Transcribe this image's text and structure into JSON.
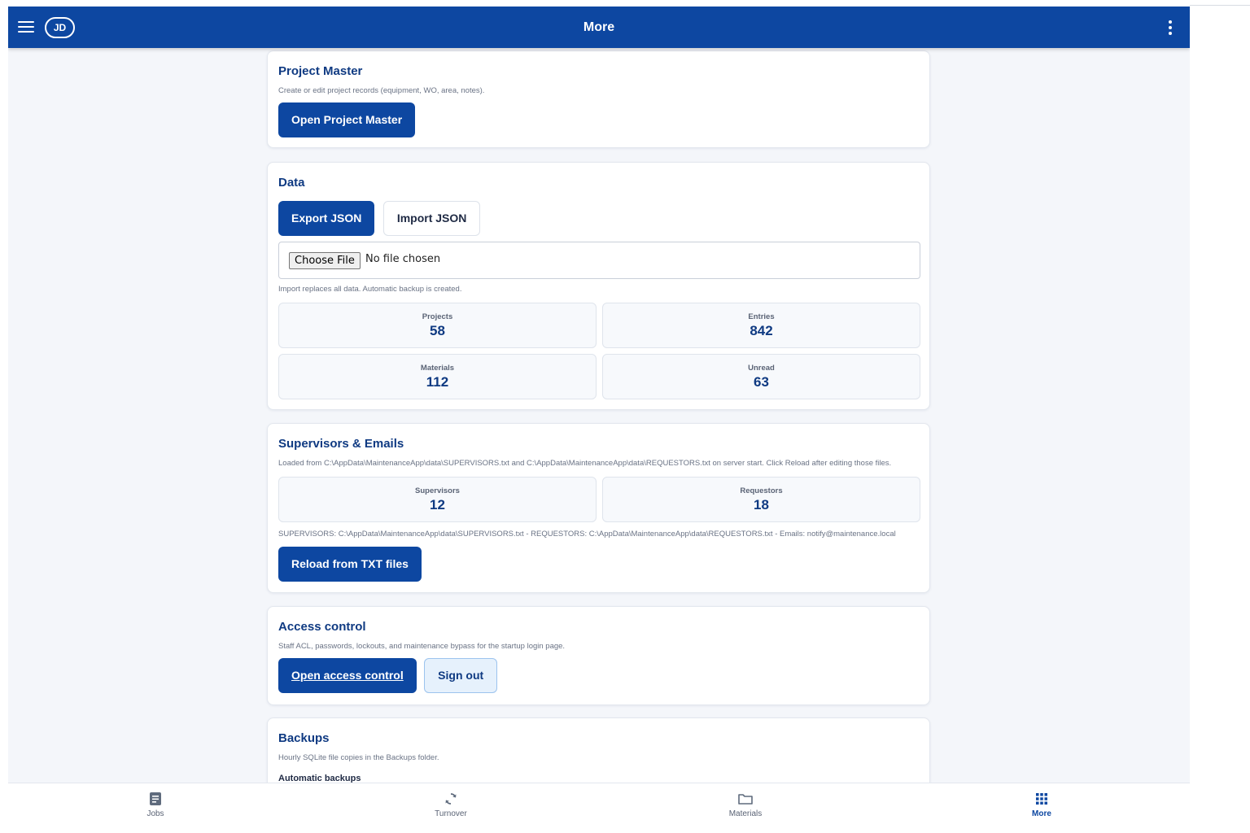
{
  "appbar": {
    "title": "More",
    "avatar_initials": "JD"
  },
  "project_master": {
    "title": "Project Master",
    "description": "Create or edit project records (equipment, WO, area, notes).",
    "open_button": "Open Project Master"
  },
  "data": {
    "title": "Data",
    "export_button": "Export JSON",
    "import_button": "Import JSON",
    "file_input": {
      "button": "Choose File",
      "status": "No file chosen"
    },
    "note": "Import replaces all data. Automatic backup is created.",
    "stats": [
      {
        "label": "Projects",
        "value": "58"
      },
      {
        "label": "Entries",
        "value": "842"
      },
      {
        "label": "Materials",
        "value": "112"
      },
      {
        "label": "Unread",
        "value": "63"
      }
    ]
  },
  "supervisors": {
    "title": "Supervisors & Emails",
    "description": "Loaded from C:\\AppData\\MaintenanceApp\\data\\SUPERVISORS.txt and C:\\AppData\\MaintenanceApp\\data\\REQUESTORS.txt on server start. Click Reload after editing those files.",
    "stats": [
      {
        "label": "Supervisors",
        "value": "12"
      },
      {
        "label": "Requestors",
        "value": "18"
      }
    ],
    "paths": "SUPERVISORS: C:\\AppData\\MaintenanceApp\\data\\SUPERVISORS.txt - REQUESTORS: C:\\AppData\\MaintenanceApp\\data\\REQUESTORS.txt - Emails: notify@maintenance.local",
    "reload_button": "Reload from TXT files"
  },
  "access_control": {
    "title": "Access control",
    "description": "Staff ACL, passwords, lockouts, and maintenance bypass for the startup login page.",
    "open_button": "Open access control",
    "signout_button": "Sign out"
  },
  "backups": {
    "title": "Backups",
    "description": "Hourly SQLite file copies in the Backups folder.",
    "subhead": "Automatic backups"
  },
  "bottom_nav": [
    {
      "label": "Jobs",
      "icon": "document-icon"
    },
    {
      "label": "Turnover",
      "icon": "sync-icon"
    },
    {
      "label": "Materials",
      "icon": "folder-icon"
    },
    {
      "label": "More",
      "icon": "grid-icon"
    }
  ],
  "colors": {
    "primary": "#0d47a1",
    "background": "#f4f6fa",
    "accent_light": "#e6f1fc"
  }
}
